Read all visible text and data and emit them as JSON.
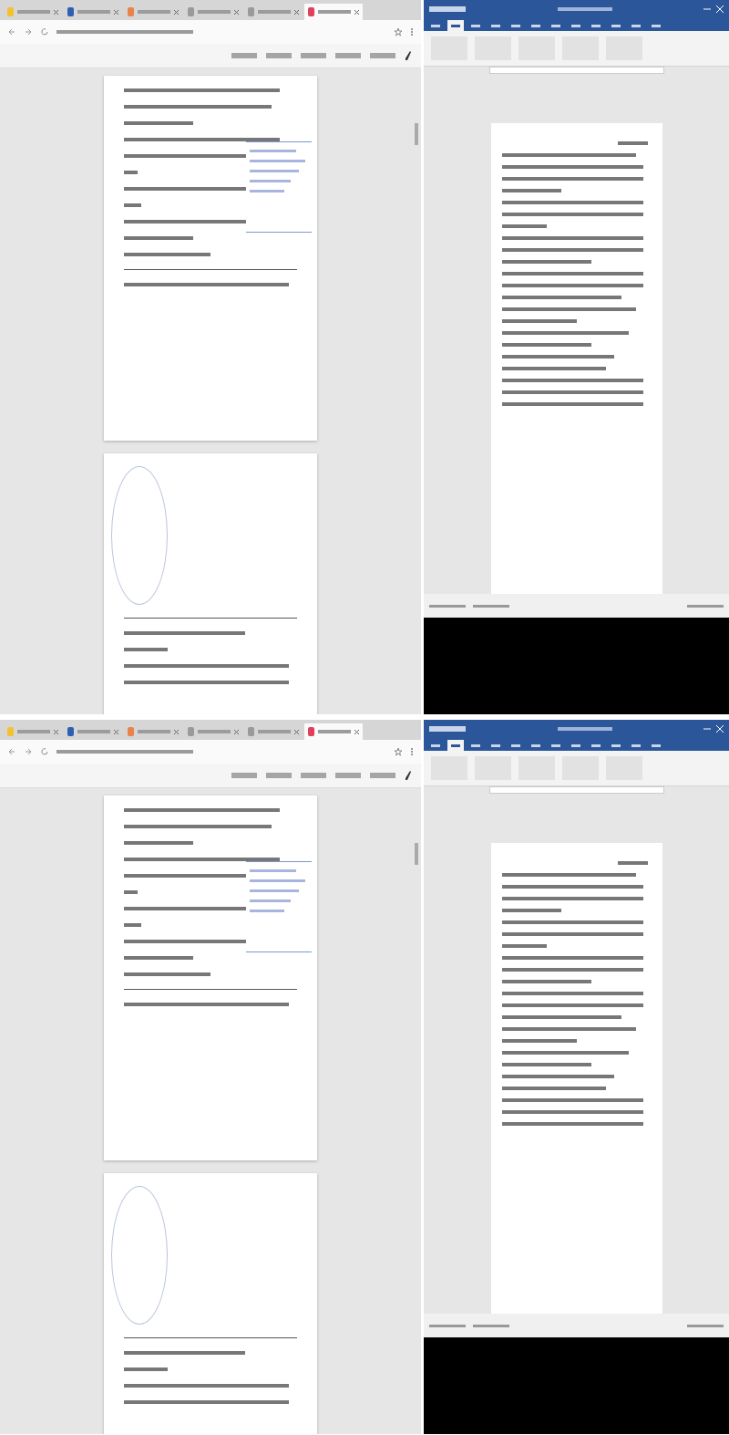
{
  "screens": [
    {
      "browser": {
        "tabs": [
          {
            "selected": false,
            "color": "#f2c230"
          },
          {
            "selected": false,
            "color": "#2f5fb3"
          },
          {
            "selected": false,
            "color": "#e8834a"
          },
          {
            "selected": false,
            "color": "#9a9a9a"
          },
          {
            "selected": false,
            "color": "#9a9a9a"
          },
          {
            "selected": true,
            "color": "#e0405a"
          }
        ],
        "pdf_pages": [
          {
            "kind": "text"
          },
          {
            "kind": "signature"
          }
        ]
      },
      "word": {
        "ribbon_tabs": [
          {
            "selected": false
          },
          {
            "selected": true
          },
          {
            "selected": false
          },
          {
            "selected": false
          },
          {
            "selected": false
          },
          {
            "selected": false
          },
          {
            "selected": false
          },
          {
            "selected": false
          },
          {
            "selected": false
          },
          {
            "selected": false
          },
          {
            "selected": false
          },
          {
            "selected": false
          }
        ]
      }
    },
    {
      "browser": {
        "tabs": [
          {
            "selected": false,
            "color": "#f2c230"
          },
          {
            "selected": false,
            "color": "#2f5fb3"
          },
          {
            "selected": false,
            "color": "#e8834a"
          },
          {
            "selected": false,
            "color": "#9a9a9a"
          },
          {
            "selected": false,
            "color": "#9a9a9a"
          },
          {
            "selected": true,
            "color": "#e0405a"
          }
        ],
        "pdf_pages": [
          {
            "kind": "text"
          },
          {
            "kind": "signature"
          }
        ]
      },
      "word": {
        "ribbon_tabs": [
          {
            "selected": false
          },
          {
            "selected": true
          },
          {
            "selected": false
          },
          {
            "selected": false
          },
          {
            "selected": false
          },
          {
            "selected": false
          },
          {
            "selected": false
          },
          {
            "selected": false
          },
          {
            "selected": false
          },
          {
            "selected": false
          },
          {
            "selected": false
          },
          {
            "selected": false
          }
        ]
      }
    }
  ]
}
